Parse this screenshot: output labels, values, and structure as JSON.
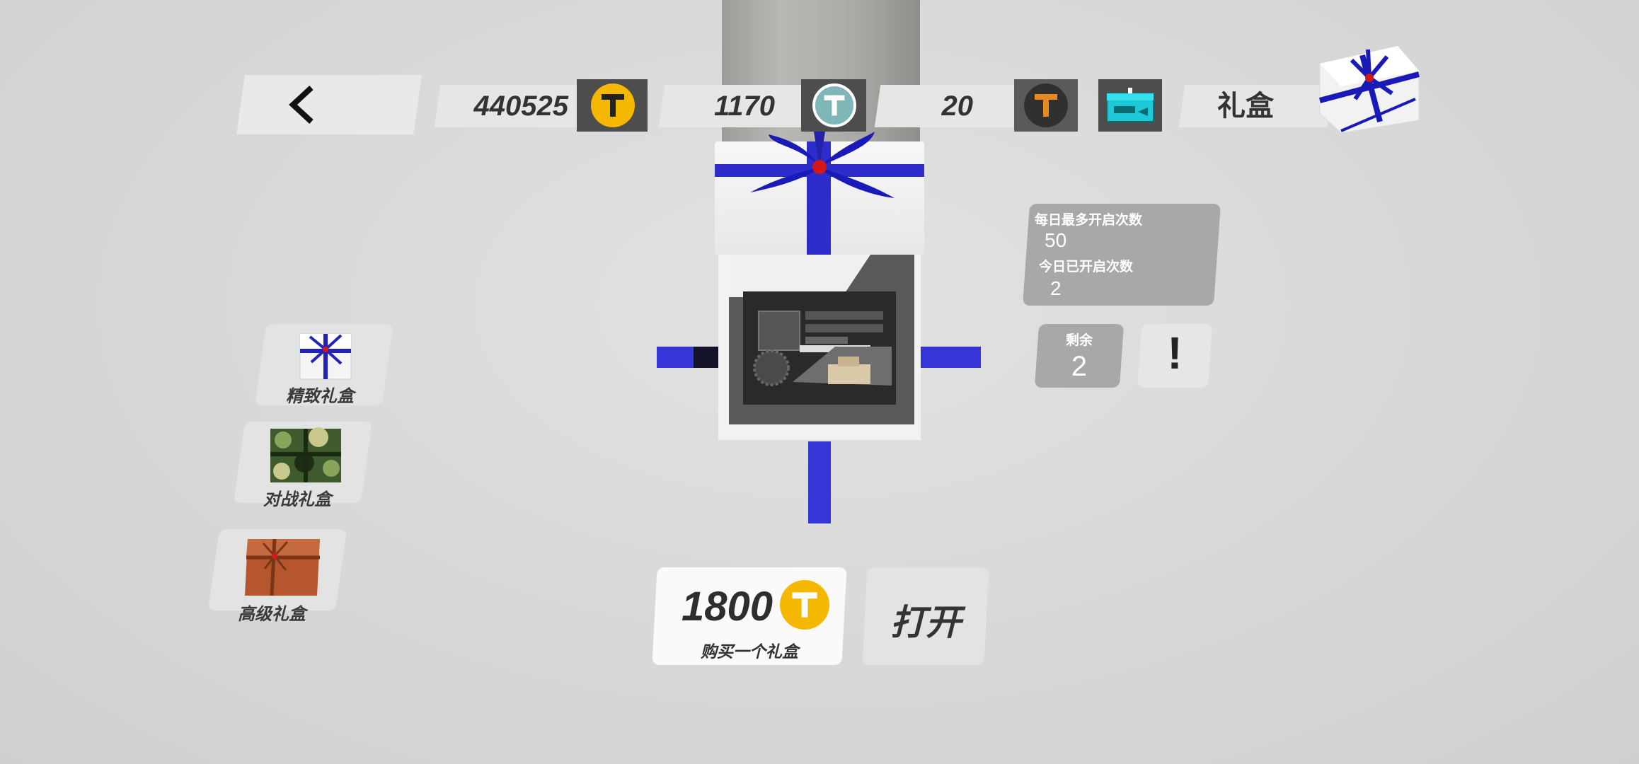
{
  "top_bar": {
    "currency_gold": "440525",
    "currency_silver": "1170",
    "currency_bronze": "20",
    "title": "礼盒"
  },
  "info": {
    "daily_max_label": "每日最多开启次数",
    "daily_max_value": "50",
    "today_opened_label": "今日已开启次数",
    "today_opened_value": "2",
    "remaining_label": "剩余",
    "remaining_value": "2",
    "help_symbol": "!"
  },
  "gift_list": [
    {
      "label": "精致礼盒"
    },
    {
      "label": "对战礼盒"
    },
    {
      "label": "高级礼盒"
    }
  ],
  "buy": {
    "price": "1800",
    "label": "购买一个礼盒"
  },
  "open_label": "打开",
  "icons": {
    "back": "chevron-left-icon",
    "gold": "gold-coin-icon",
    "silver": "silver-coin-icon",
    "bronze": "bronze-coin-icon",
    "ticket": "ticket-icon"
  },
  "colors": {
    "ribbon": "#2d2dcc",
    "gold_coin": "#f5b800",
    "silver_coin": "#7fb7b8",
    "bronze_coin": "#e8891e",
    "ticket": "#1ec8d6"
  }
}
